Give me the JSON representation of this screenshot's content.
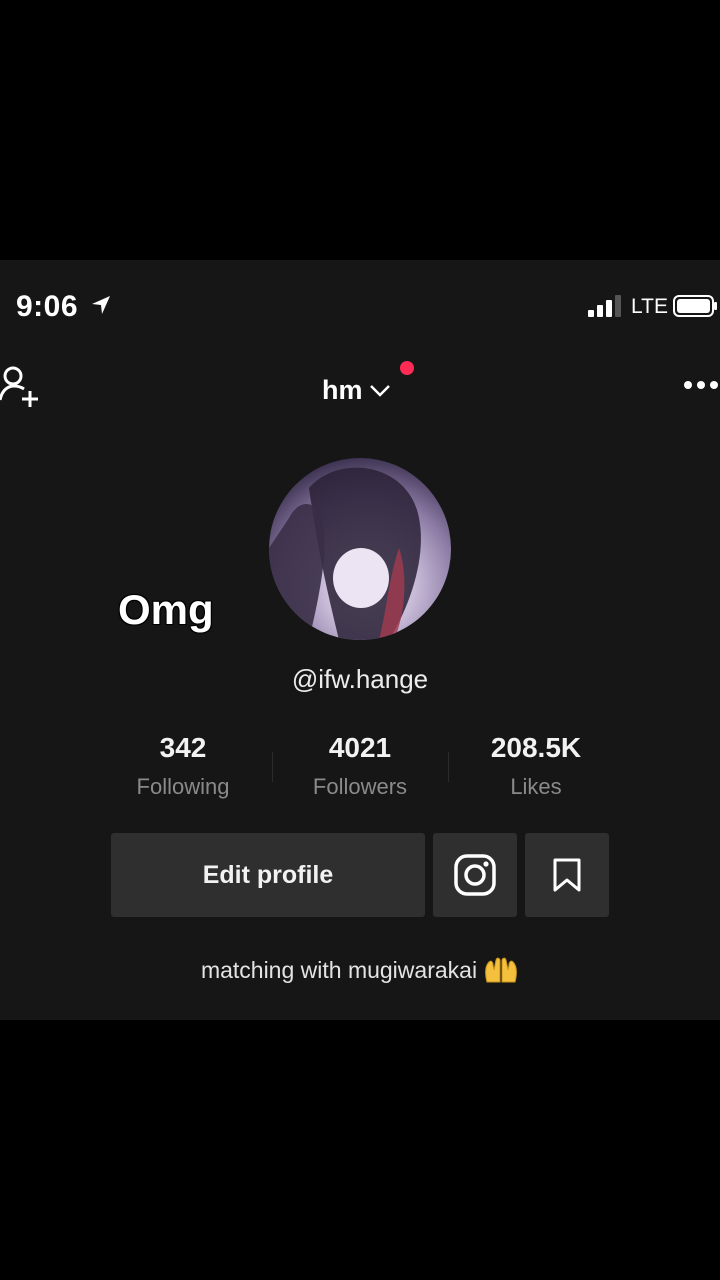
{
  "status_bar": {
    "time": "9:06",
    "network": "LTE"
  },
  "profile": {
    "username": "hm",
    "handle": "@ifw.hange",
    "overlay_caption": "Omg",
    "bio": "matching with mugiwarakai"
  },
  "stats": [
    {
      "value": "342",
      "label": "Following"
    },
    {
      "value": "4021",
      "label": "Followers"
    },
    {
      "value": "208.5K",
      "label": "Likes"
    }
  ],
  "actions": {
    "edit_profile": "Edit profile"
  },
  "icons": [
    "location-arrow-icon",
    "signal-icon",
    "battery-icon",
    "add-user-icon",
    "chevron-down-icon",
    "more-icon",
    "instagram-icon",
    "bookmark-icon",
    "raised-hands-icon"
  ],
  "colors": {
    "notification_dot": "#fe2c55",
    "background": "#161616",
    "button": "#2f2f2f"
  }
}
